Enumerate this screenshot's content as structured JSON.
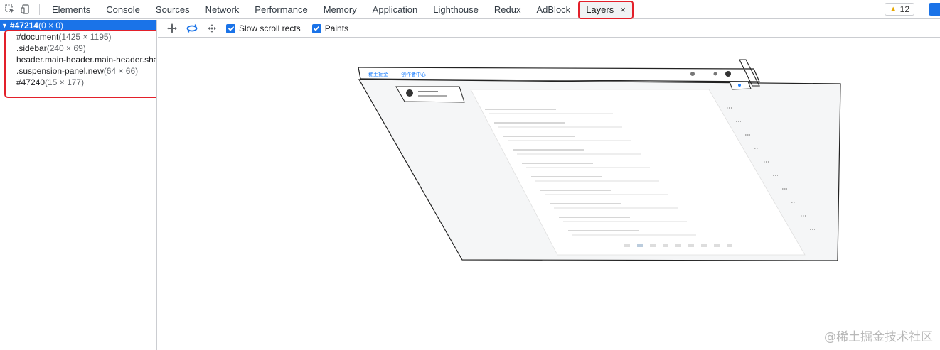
{
  "tabs": [
    {
      "label": "Elements"
    },
    {
      "label": "Console"
    },
    {
      "label": "Sources"
    },
    {
      "label": "Network"
    },
    {
      "label": "Performance"
    },
    {
      "label": "Memory"
    },
    {
      "label": "Application"
    },
    {
      "label": "Lighthouse"
    },
    {
      "label": "Redux"
    },
    {
      "label": "AdBlock"
    },
    {
      "label": "Layers",
      "active": true,
      "close": "×"
    }
  ],
  "badges": {
    "warnings": "12",
    "warning_icon": "warning-triangle-icon"
  },
  "layer_tree": {
    "root": {
      "name": "#47214",
      "size": "(0 × 0)"
    },
    "children": [
      {
        "name": "#document",
        "size": "(1425 × 1195)"
      },
      {
        "name": ".sidebar",
        "size": "(240 × 69)"
      },
      {
        "name": "header.main-header.main-header.sha",
        "size": ""
      },
      {
        "name": ".suspension-panel.new",
        "size": "(64 × 66)"
      },
      {
        "name": "#47240",
        "size": "(15 × 177)"
      }
    ]
  },
  "toolbar": {
    "icons": [
      "pan-mode-icon",
      "rotate-mode-icon",
      "reset-transform-icon"
    ],
    "slow_scroll_rects": "Slow scroll rects",
    "paints": "Paints"
  },
  "viewport": {
    "header_logo": "稀土掘金",
    "header_sub": "创作者中心",
    "watermark": "@稀土掘金技术社区"
  },
  "colors": {
    "accent": "#1a73e8",
    "highlight": "#e3202a"
  }
}
